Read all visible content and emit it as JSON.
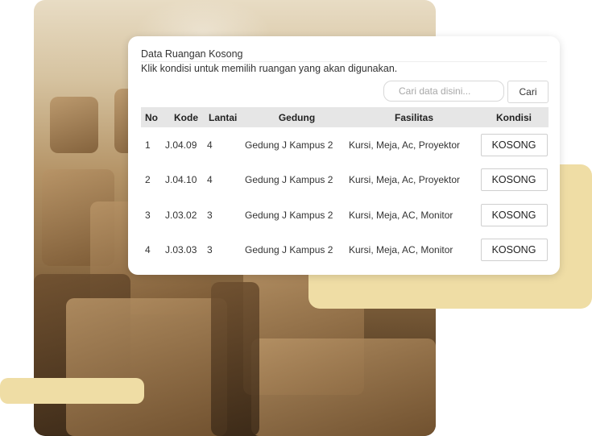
{
  "card": {
    "title": "Data Ruangan Kosong",
    "subtitle": "Klik kondisi untuk memilih ruangan yang akan digunakan."
  },
  "search": {
    "placeholder": "Cari data disini...",
    "value": "",
    "button_label": "Cari"
  },
  "table": {
    "headers": [
      "No",
      "Kode",
      "Lantai",
      "Gedung",
      "Fasilitas",
      "Kondisi"
    ],
    "rows": [
      {
        "no": "1",
        "kode": "J.04.09",
        "lantai": "4",
        "gedung": "Gedung J Kampus 2",
        "fasilitas": "Kursi, Meja, Ac, Proyektor",
        "kondisi": "KOSONG"
      },
      {
        "no": "2",
        "kode": "J.04.10",
        "lantai": "4",
        "gedung": "Gedung J Kampus 2",
        "fasilitas": "Kursi, Meja, Ac, Proyektor",
        "kondisi": "KOSONG"
      },
      {
        "no": "3",
        "kode": "J.03.02",
        "lantai": "3",
        "gedung": "Gedung J Kampus 2",
        "fasilitas": "Kursi, Meja, AC, Monitor",
        "kondisi": "KOSONG"
      },
      {
        "no": "4",
        "kode": "J.03.03",
        "lantai": "3",
        "gedung": "Gedung J Kampus 2",
        "fasilitas": "Kursi, Meja, AC, Monitor",
        "kondisi": "KOSONG"
      }
    ]
  },
  "colors": {
    "accent_decor": "#efdda5",
    "header_bg": "#e6e6e6"
  }
}
